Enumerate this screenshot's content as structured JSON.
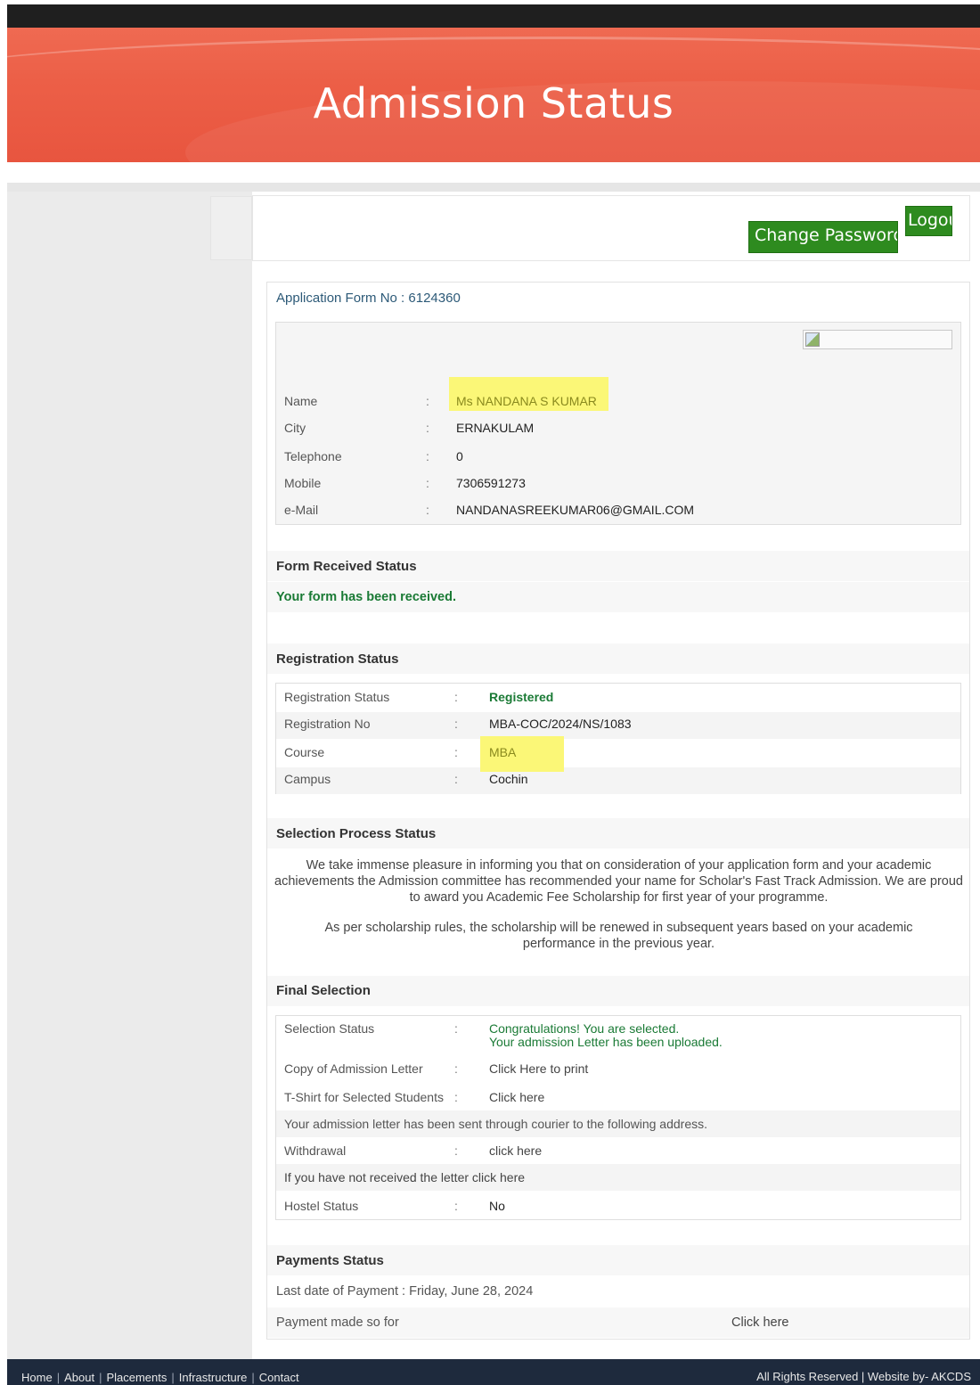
{
  "header": {
    "title": "Admission Status"
  },
  "toolbar": {
    "change_password": "Change Password",
    "logout": "Logou"
  },
  "application": {
    "form_no_label": "Application Form No : 6124360"
  },
  "personal": {
    "rows": [
      {
        "key": "Name",
        "value": "Ms NANDANA S KUMAR"
      },
      {
        "key": "City",
        "value": "ERNAKULAM"
      },
      {
        "key": "Telephone",
        "value": "0"
      },
      {
        "key": "Mobile",
        "value": "7306591273"
      },
      {
        "key": "e-Mail",
        "value": "NANDANASREEKUMAR06@GMAIL.COM"
      }
    ]
  },
  "form_received": {
    "title": "Form Received Status",
    "message": "Your form has been received."
  },
  "registration": {
    "title": "Registration Status",
    "rows": [
      {
        "key": "Registration Status",
        "value": "Registered"
      },
      {
        "key": "Registration No",
        "value": "MBA-COC/2024/NS/1083"
      },
      {
        "key": "Course",
        "value": "MBA"
      },
      {
        "key": "Campus",
        "value": "Cochin"
      }
    ]
  },
  "selection_process": {
    "title": "Selection Process Status",
    "para1": "We take immense pleasure in informing you that on consideration of your application form and your academic achievements the Admission committee has recommended your name for Scholar's Fast Track Admission. We are proud to award you Academic Fee Scholarship for first year of your programme.",
    "para2": "As per scholarship rules, the scholarship will be renewed in subsequent years based on your academic performance in the previous year."
  },
  "final_selection": {
    "title": "Final Selection",
    "selection_status_key": "Selection Status",
    "selection_status_line1": "Congratulations! You are selected.",
    "selection_status_line2": "Your admission Letter has been uploaded.",
    "admission_letter_key": "Copy of Admission Letter",
    "admission_letter_value": "Click Here to print",
    "tshirt_key": "T-Shirt for Selected Students",
    "tshirt_value": "Click here",
    "courier_note": "Your admission letter has been sent through courier to the following address.",
    "withdrawal_key": "Withdrawal",
    "withdrawal_value": "click here",
    "not_received_note": "If you have not received the letter click here",
    "hostel_key": "Hostel Status",
    "hostel_value": "No"
  },
  "payments": {
    "title": "Payments Status",
    "last_date": "Last date of Payment : Friday, June 28, 2024",
    "made_so_far": "Payment made so for",
    "click_here": "Click here"
  },
  "footer": {
    "links": [
      "Home",
      "About",
      "Placements",
      "Infrastructure",
      "Contact"
    ],
    "rights": "All Rights Reserved | Website by- AKCDS"
  },
  "colors": {
    "banner": "#ec5f47",
    "button_green": "#2e8b1f",
    "highlight": "#fbf777",
    "status_green": "#1a7a35",
    "footer": "#1e2a3d"
  }
}
